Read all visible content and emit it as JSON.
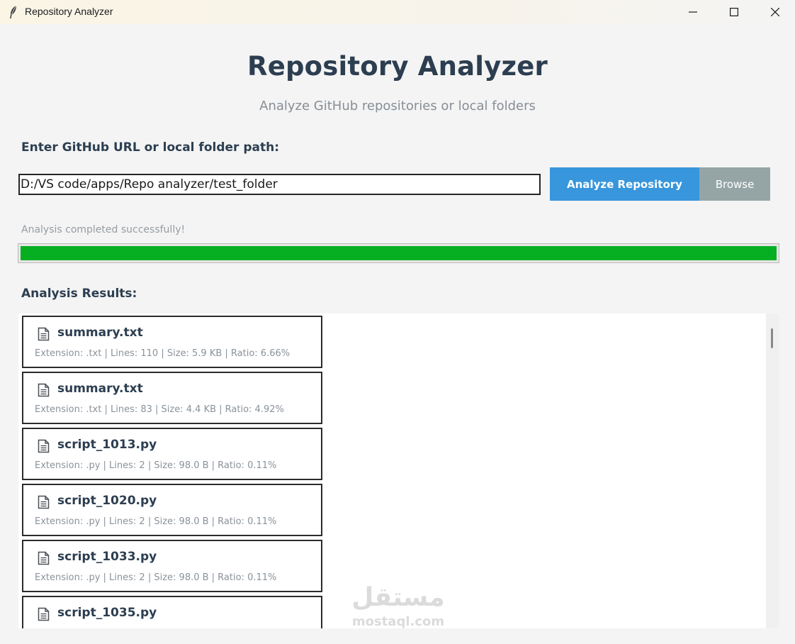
{
  "window": {
    "title": "Repository Analyzer",
    "icon": "feather-icon"
  },
  "header": {
    "title": "Repository Analyzer",
    "subtitle": "Analyze GitHub repositories or local folders"
  },
  "input": {
    "label": "Enter GitHub URL or local folder path:",
    "value": "D:/VS code/apps/Repo analyzer/test_folder"
  },
  "buttons": {
    "analyze": "Analyze Repository",
    "browse": "Browse"
  },
  "status": {
    "text": "Analysis completed successfully!",
    "progress_percent": 100
  },
  "results": {
    "label": "Analysis Results:",
    "files": [
      {
        "name": "summary.txt",
        "meta": "Extension: .txt | Lines: 110 | Size: 5.9 KB | Ratio: 6.66%"
      },
      {
        "name": "summary.txt",
        "meta": "Extension: .txt | Lines: 83 | Size: 4.4 KB | Ratio: 4.92%"
      },
      {
        "name": "script_1013.py",
        "meta": "Extension: .py | Lines: 2 | Size: 98.0 B | Ratio: 0.11%"
      },
      {
        "name": "script_1020.py",
        "meta": "Extension: .py | Lines: 2 | Size: 98.0 B | Ratio: 0.11%"
      },
      {
        "name": "script_1033.py",
        "meta": "Extension: .py | Lines: 2 | Size: 98.0 B | Ratio: 0.11%"
      },
      {
        "name": "script_1035.py",
        "meta": ""
      }
    ]
  },
  "watermark": {
    "arabic": "مستقل",
    "latin": "mostaql.com"
  },
  "colors": {
    "title": "#2c3e50",
    "analyze_button": "#3796dc",
    "browse_button": "#95a5a6",
    "progress": "#06ae22"
  }
}
